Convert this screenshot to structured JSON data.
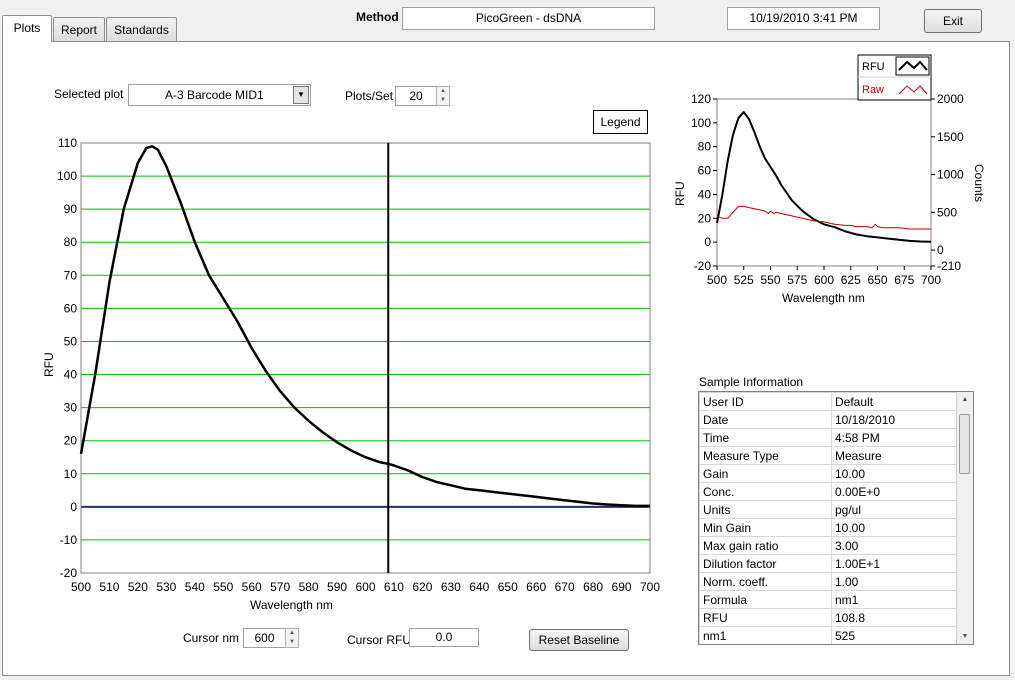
{
  "tabs": [
    {
      "label": "Plots",
      "active": true
    },
    {
      "label": "Report",
      "active": false
    },
    {
      "label": "Standards",
      "active": false
    }
  ],
  "header": {
    "method_label": "Method",
    "method_value": "PicoGreen - dsDNA",
    "datetime": "10/19/2010  3:41 PM",
    "exit_label": "Exit"
  },
  "controls": {
    "selected_plot_label": "Selected plot",
    "selected_plot_value": "A-3 Barcode MID1",
    "plots_per_set_label": "Plots/Set",
    "plots_per_set_value": "20",
    "legend_button": "Legend",
    "cursor_nm_label": "Cursor nm",
    "cursor_nm_value": "600",
    "cursor_rfu_label": "Cursor RFU",
    "cursor_rfu_value": "0.0",
    "reset_baseline_label": "Reset Baseline"
  },
  "chart_data": [
    {
      "type": "line",
      "xlabel": "Wavelength nm",
      "ylabel": "RFU",
      "xlim": [
        500,
        700
      ],
      "ylim": [
        -20,
        110
      ],
      "x_ticks": [
        "500",
        "510",
        "520",
        "530",
        "540",
        "550",
        "560",
        "570",
        "580",
        "590",
        "600",
        "610",
        "620",
        "630",
        "640",
        "650",
        "660",
        "670",
        "680",
        "690",
        "700"
      ],
      "y_ticks": [
        "110",
        "100",
        "90",
        "80",
        "70",
        "60",
        "50",
        "40",
        "30",
        "20",
        "10",
        "0",
        "-10",
        "-20"
      ],
      "grid": "horizontal",
      "grid_color": "#00c000",
      "baseline_color": "#1f2f5f",
      "cursor_x": 608,
      "series": [
        {
          "color": "#000000",
          "x": [
            500,
            505,
            510,
            515,
            520,
            523,
            525,
            527,
            530,
            535,
            540,
            545,
            550,
            555,
            560,
            565,
            570,
            575,
            580,
            585,
            590,
            595,
            600,
            605,
            608,
            610,
            615,
            620,
            625,
            630,
            635,
            640,
            645,
            650,
            655,
            660,
            665,
            670,
            675,
            680,
            685,
            690,
            695,
            700
          ],
          "y": [
            16,
            40,
            68,
            90,
            104,
            108.5,
            109,
            108,
            103,
            92,
            80,
            70,
            63,
            56,
            48,
            41,
            35,
            30,
            26,
            22.5,
            19.5,
            17,
            15,
            13.5,
            13,
            12.5,
            11,
            9,
            7.5,
            6.5,
            5.5,
            5,
            4.5,
            4,
            3.5,
            3,
            2.5,
            2,
            1.5,
            1,
            0.7,
            0.5,
            0.3,
            0.3
          ]
        }
      ]
    },
    {
      "type": "line",
      "xlabel": "Wavelength  nm",
      "ylabel": "RFU",
      "y2label": "Counts",
      "xlim": [
        500,
        700
      ],
      "ylim": [
        -20,
        120
      ],
      "y2lim": [
        -210,
        2000
      ],
      "x_ticks": [
        "500",
        "525",
        "550",
        "575",
        "600",
        "625",
        "650",
        "675",
        "700"
      ],
      "y_ticks": [
        "120",
        "100",
        "80",
        "60",
        "40",
        "20",
        "0",
        "-20"
      ],
      "y2_ticks": [
        "2000",
        "1500",
        "1000",
        "500",
        "0",
        "-210"
      ],
      "legend": {
        "placement": "top-right"
      },
      "series": [
        {
          "name": "RFU",
          "color": "#000000",
          "x": [
            500,
            505,
            510,
            515,
            520,
            525,
            530,
            535,
            540,
            545,
            550,
            555,
            560,
            570,
            580,
            590,
            600,
            610,
            620,
            630,
            640,
            650,
            660,
            670,
            680,
            690,
            700
          ],
          "y": [
            16,
            40,
            68,
            90,
            104,
            109,
            103,
            92,
            80,
            70,
            63,
            56,
            48,
            35,
            26,
            19.5,
            15,
            12.5,
            9,
            6.5,
            5,
            4,
            3,
            2,
            1,
            0.5,
            0.3
          ]
        },
        {
          "name": "Raw",
          "color": "#c00000",
          "x": [
            500,
            505,
            510,
            515,
            520,
            525,
            530,
            535,
            540,
            545,
            548,
            550,
            553,
            555,
            560,
            565,
            570,
            575,
            580,
            590,
            600,
            610,
            620,
            625,
            630,
            640,
            645,
            648,
            650,
            655,
            660,
            670,
            680,
            690,
            700
          ],
          "y": [
            22,
            20,
            20,
            25,
            30,
            30,
            29,
            28,
            27,
            26,
            24,
            26,
            24,
            25,
            24,
            23,
            22,
            21,
            20,
            18,
            17,
            15,
            14,
            14,
            13,
            13,
            12,
            15,
            13,
            12,
            12,
            12,
            11,
            11,
            11
          ]
        }
      ]
    }
  ],
  "sample_info": {
    "title": "Sample Information",
    "rows": [
      {
        "key": "User ID",
        "value": "Default"
      },
      {
        "key": "Date",
        "value": "10/18/2010"
      },
      {
        "key": "Time",
        "value": "4:58 PM"
      },
      {
        "key": "Measure Type",
        "value": "Measure"
      },
      {
        "key": "Gain",
        "value": "10.00"
      },
      {
        "key": "Conc.",
        "value": "0.00E+0"
      },
      {
        "key": "Units",
        "value": "pg/ul"
      },
      {
        "key": "Min Gain",
        "value": "10.00"
      },
      {
        "key": "Max gain ratio",
        "value": "3.00"
      },
      {
        "key": "Dilution factor",
        "value": "1.00E+1"
      },
      {
        "key": "Norm. coeff.",
        "value": "1.00"
      },
      {
        "key": "Formula",
        "value": "nm1"
      },
      {
        "key": "RFU",
        "value": "108.8"
      },
      {
        "key": "nm1",
        "value": "525"
      }
    ]
  }
}
